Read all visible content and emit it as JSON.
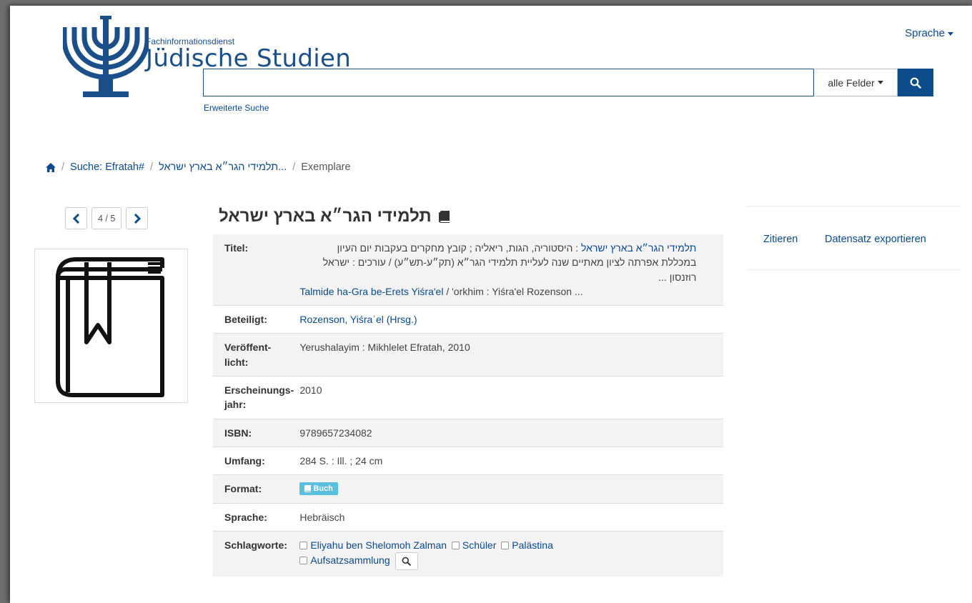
{
  "header": {
    "logo_sub": "Fachinformationsdienst",
    "logo_main": "Jüdische Studien",
    "language_label": "Sprache",
    "search_value": "",
    "field_select_label": "alle Felder",
    "advanced_search_label": "Erweiterte Suche"
  },
  "breadcrumb": {
    "search": "Suche: Efratah#",
    "record": "...תלמידי הגר״א בארץ ישראל",
    "current": "Exemplare",
    "separator": "/"
  },
  "pager": {
    "count": "4 / 5"
  },
  "record": {
    "title": "תלמידי הגר״א בארץ ישראל",
    "rows": {
      "titel_label": "Titel:",
      "titel_heb_link": "תלמידי הגר״א בארץ ישראל",
      "titel_heb_rest": " : היסטוריה, הגות, ריאליה ; קובץ מחקרים בעקבות יום העיון במכללת אפרתה לציון מאתיים שנה לעליית תלמידי הגר״א (תק״ע-תש״ע) / עורכים : ישראל רוזנסון ...",
      "titel_translit_link": "Talmide ha-Gra be-Erets Yiśra'el",
      "titel_translit_rest": " / 'orkhim : Yiśra'el Rozenson ...",
      "beteiligt_label": "Beteiligt:",
      "beteiligt_value": "Rozenson, Yiśraʾel (Hrsg.)",
      "veroeff_label": "Veröffent- licht:",
      "veroeff_value": "Yerushalayim : Mikhlelet Efratah, 2010",
      "jahr_label": "Erscheinungs- jahr:",
      "jahr_value": "2010",
      "isbn_label": "ISBN:",
      "isbn_value": "9789657234082",
      "umfang_label": "Umfang:",
      "umfang_value": "284 S. : Ill. ; 24 cm",
      "format_label": "Format:",
      "format_value": "Buch",
      "sprache_label": "Sprache:",
      "sprache_value": "Hebräisch",
      "schlagworte_label": "Schlagworte:",
      "schlagworte": [
        "Eliyahu ben Shelomoh Zalman",
        "Schüler",
        "Palästina",
        "Aufsatzsammlung"
      ]
    }
  },
  "side_actions": {
    "cite": "Zitieren",
    "export": "Datensatz exportieren"
  },
  "colors": {
    "primary": "#0d4d8b",
    "link": "#0b4a8c",
    "badge": "#5bc0de"
  }
}
